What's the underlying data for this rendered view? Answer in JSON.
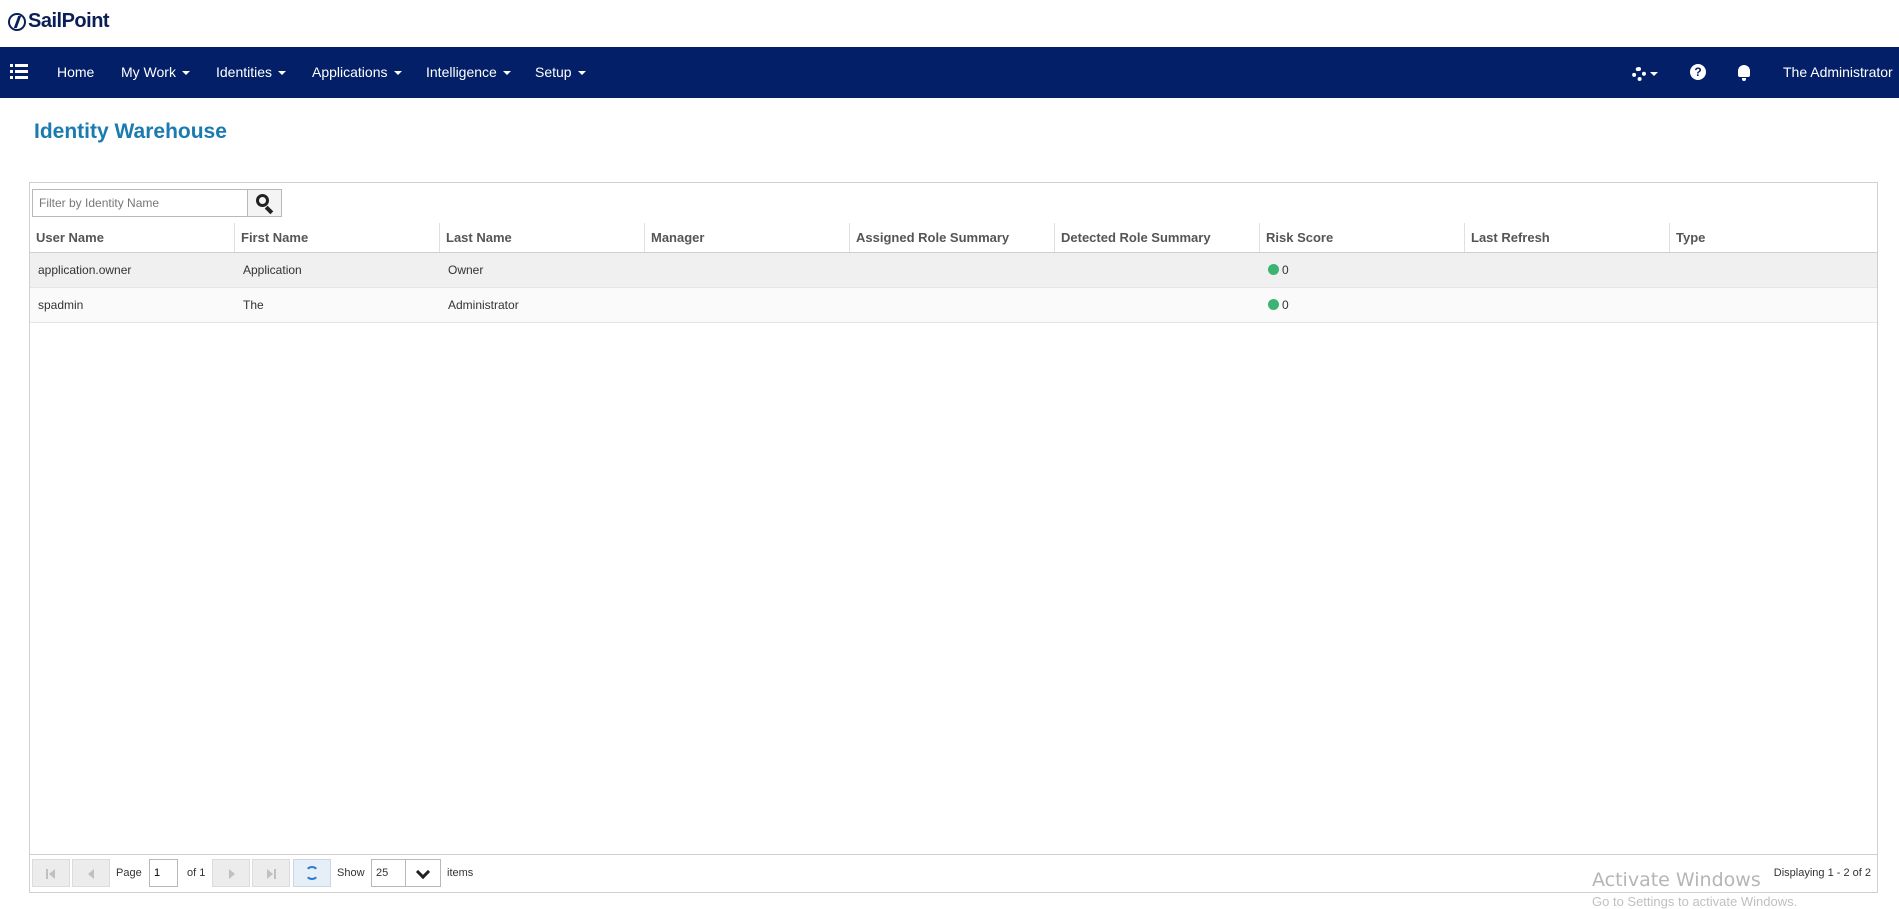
{
  "brand": {
    "name": "SailPoint"
  },
  "nav": {
    "items": [
      {
        "label": "Home",
        "caret": false
      },
      {
        "label": "My Work",
        "caret": true
      },
      {
        "label": "Identities",
        "caret": true
      },
      {
        "label": "Applications",
        "caret": true
      },
      {
        "label": "Intelligence",
        "caret": true
      },
      {
        "label": "Setup",
        "caret": true
      }
    ],
    "help_glyph": "?",
    "user": "The Administrator",
    "icons": [
      "menu-icon",
      "gear-icon",
      "help-icon",
      "bell-icon"
    ]
  },
  "page": {
    "title": "Identity Warehouse"
  },
  "search": {
    "placeholder": "Filter by Identity Name",
    "value": ""
  },
  "grid": {
    "columns": [
      "User Name",
      "First Name",
      "Last Name",
      "Manager",
      "Assigned Role Summary",
      "Detected Role Summary",
      "Risk Score",
      "Last Refresh",
      "Type"
    ],
    "rows": [
      {
        "user_name": "application.owner",
        "first_name": "Application",
        "last_name": "Owner",
        "manager": "",
        "assigned_role_summary": "",
        "detected_role_summary": "",
        "risk_score": "0",
        "last_refresh": "",
        "type": ""
      },
      {
        "user_name": "spadmin",
        "first_name": "The",
        "last_name": "Administrator",
        "manager": "",
        "assigned_role_summary": "",
        "detected_role_summary": "",
        "risk_score": "0",
        "last_refresh": "",
        "type": ""
      }
    ],
    "risk_color": "#3cb371"
  },
  "pager": {
    "page_label": "Page",
    "page_value": "1",
    "of_label": "of 1",
    "show_label": "Show",
    "page_size": "25",
    "items_label": "items",
    "displaying": "Displaying 1 - 2 of 2"
  },
  "watermark": {
    "title": "Activate Windows",
    "subtitle": "Go to Settings to activate Windows."
  },
  "colors": {
    "nav_bg": "#021f67",
    "title": "#1a7bb0",
    "brand": "#0b1f57"
  }
}
